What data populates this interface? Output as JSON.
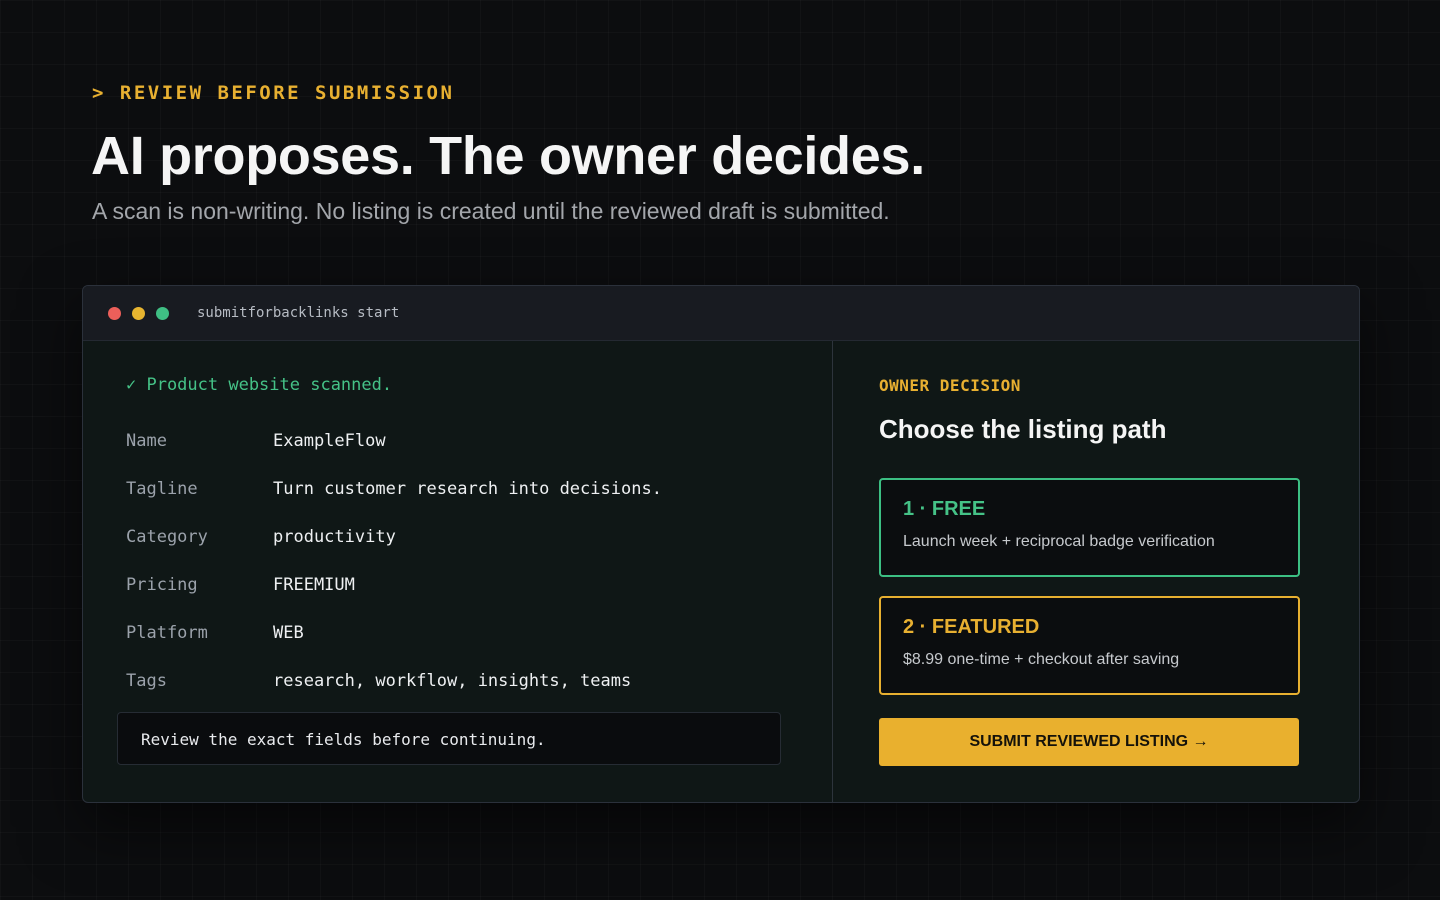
{
  "hero": {
    "eyebrow": "> REVIEW BEFORE SUBMISSION",
    "headline": "AI proposes. The owner decides.",
    "subhead": "A scan is non-writing. No listing is created until the reviewed draft is submitted."
  },
  "window": {
    "command": "submitforbacklinks start",
    "traffic_lights": [
      "#ec5f5a",
      "#e7b530",
      "#3fbf84"
    ]
  },
  "scan": {
    "status": "✓ Product website scanned.",
    "fields": [
      {
        "label": "Name",
        "value": "ExampleFlow"
      },
      {
        "label": "Tagline",
        "value": "Turn customer research into decisions."
      },
      {
        "label": "Category",
        "value": "productivity"
      },
      {
        "label": "Pricing",
        "value": "FREEMIUM"
      },
      {
        "label": "Platform",
        "value": "WEB"
      },
      {
        "label": "Tags",
        "value": "research, workflow, insights, teams"
      }
    ],
    "note": "Review the exact fields before continuing."
  },
  "decision": {
    "eyebrow": "OWNER DECISION",
    "title": "Choose the listing path",
    "options": [
      {
        "title": "1 · FREE",
        "description": "Launch week + reciprocal badge verification",
        "accent": "#3cbf83"
      },
      {
        "title": "2 · FEATURED",
        "description": "$8.99 one-time + checkout after saving",
        "accent": "#e7b030"
      }
    ],
    "submit_label": "SUBMIT REVIEWED LISTING →"
  },
  "colors": {
    "background": "#0c0d0f",
    "accent_yellow": "#e8b031",
    "accent_green": "#45c287"
  }
}
